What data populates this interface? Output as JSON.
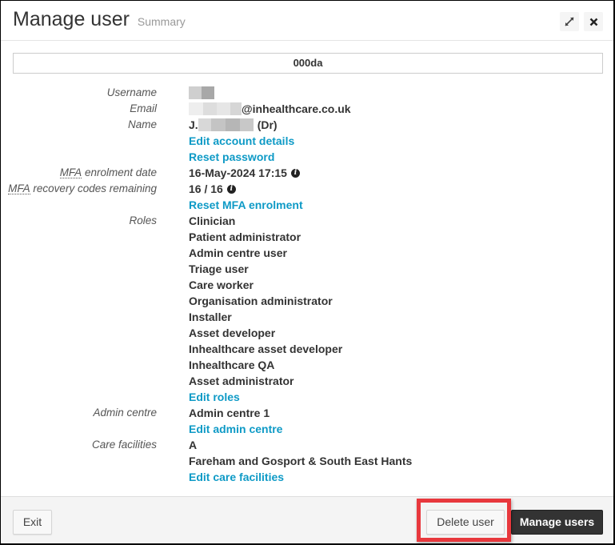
{
  "header": {
    "title": "Manage user",
    "subtitle": "Summary",
    "expand_icon": "expand-arrows-icon",
    "close_icon": "close-x-icon"
  },
  "user_code": "000da",
  "fields": {
    "username": {
      "label": "Username",
      "value": "[redacted]"
    },
    "email": {
      "label": "Email",
      "value_suffix": "@inhealthcare.co.uk"
    },
    "name": {
      "label": "Name",
      "prefix": "J.",
      "suffix": "(Dr)"
    },
    "links_account": [
      "Edit account details",
      "Reset password"
    ],
    "mfa_date": {
      "label_abbr": "MFA",
      "label_rest": " enrolment date",
      "value": "16-May-2024 17:15"
    },
    "mfa_codes": {
      "label_abbr": "MFA",
      "label_rest": " recovery codes remaining",
      "value": "16 / 16"
    },
    "link_mfa": "Reset MFA enrolment",
    "roles": {
      "label": "Roles",
      "items": [
        "Clinician",
        "Patient administrator",
        "Admin centre user",
        "Triage user",
        "Care worker",
        "Organisation administrator",
        "Installer",
        "Asset developer",
        "Inhealthcare asset developer",
        "Inhealthcare QA",
        "Asset administrator"
      ],
      "edit_link": "Edit roles"
    },
    "admin_centre": {
      "label": "Admin centre",
      "value": "Admin centre 1",
      "edit_link": "Edit admin centre"
    },
    "care_facilities": {
      "label": "Care facilities",
      "items": [
        "A",
        "Fareham and Gosport & South East Hants"
      ],
      "edit_link": "Edit care facilities"
    }
  },
  "footer": {
    "exit_label": "Exit",
    "delete_label": "Delete user",
    "manage_label": "Manage users"
  },
  "colors": {
    "link": "#0e9ac6",
    "highlight": "#e8383d",
    "primary_button": "#333333"
  }
}
